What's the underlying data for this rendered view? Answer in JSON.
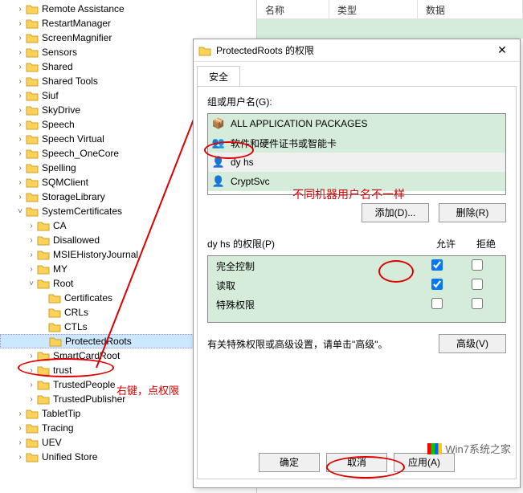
{
  "tree": {
    "items": [
      "Remote Assistance",
      "RestartManager",
      "ScreenMagnifier",
      "Sensors",
      "Shared",
      "Shared Tools",
      "Siuf",
      "SkyDrive",
      "Speech",
      "Speech Virtual",
      "Speech_OneCore",
      "Spelling",
      "SQMClient",
      "StorageLibrary",
      "SystemCertificates"
    ],
    "sc_children": [
      "CA",
      "Disallowed",
      "MSIEHistoryJournal",
      "MY",
      "Root"
    ],
    "root_children": [
      "Certificates",
      "CRLs",
      "CTLs",
      "ProtectedRoots"
    ],
    "after": [
      "SmartCardRoot",
      "trust",
      "TrustedPeople",
      "TrustedPublisher",
      "TabletTip",
      "Tracing",
      "UEV",
      "Unified Store"
    ]
  },
  "annotations": {
    "a1": "右键，点权限",
    "a2": "不同机器用户名不一样"
  },
  "listHeader": {
    "col1": "名称",
    "col2": "类型",
    "col3": "数据"
  },
  "dialog": {
    "title": "ProtectedRoots 的权限",
    "tab": "安全",
    "groupLabel": "组或用户名(G):",
    "groups": [
      "ALL APPLICATION PACKAGES",
      "软件和硬件证书或智能卡",
      "dy hs",
      "CryptSvc"
    ],
    "addBtn": "添加(D)...",
    "removeBtn": "删除(R)",
    "permLabel": "dy hs 的权限(P)",
    "allowCol": "允许",
    "denyCol": "拒绝",
    "perms": [
      "完全控制",
      "读取",
      "特殊权限"
    ],
    "advText": "有关特殊权限或高级设置，请单击\"高级\"。",
    "advBtn": "高级(V)",
    "ok": "确定",
    "cancel": "取消",
    "apply": "应用(A)"
  },
  "watermark": {
    "text": "Win7系统之家",
    "url": "www.winwin7.com"
  }
}
